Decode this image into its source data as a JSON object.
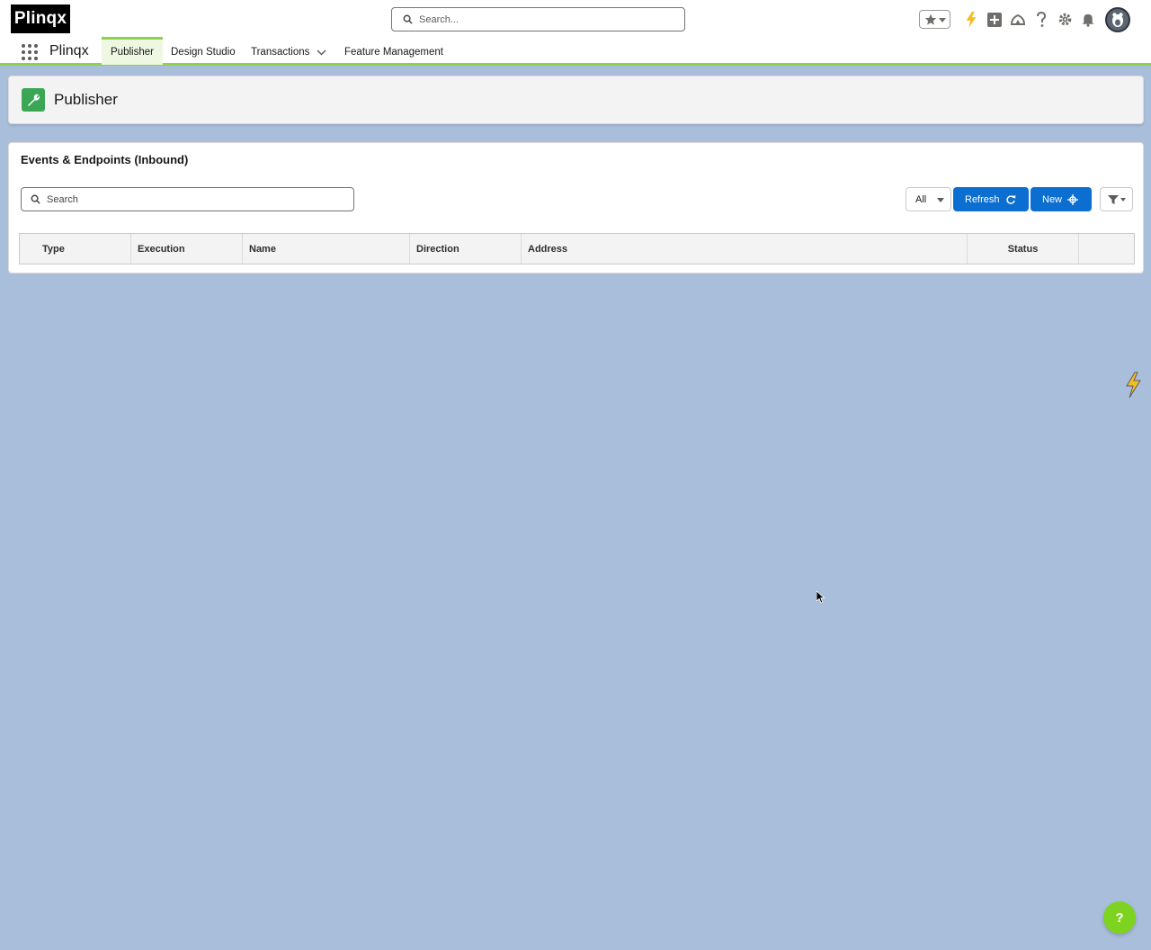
{
  "global_header": {
    "logo_text": "Plinqx",
    "search_placeholder": "Search..."
  },
  "app_nav": {
    "app_name": "Plinqx",
    "tabs": [
      {
        "label": "Publisher",
        "active": true
      },
      {
        "label": "Design Studio"
      },
      {
        "label": "Transactions",
        "has_menu": true
      },
      {
        "label": "Feature Management"
      }
    ]
  },
  "page_header": {
    "title": "Publisher"
  },
  "card": {
    "title": "Events & Endpoints (Inbound)",
    "search_placeholder": "Search",
    "filter_value": "All",
    "refresh_label": "Refresh",
    "new_label": "New",
    "columns": [
      "Type",
      "Execution",
      "Name",
      "Direction",
      "Address",
      "Status"
    ]
  },
  "help_label": "?",
  "colors": {
    "brand": "#0b6ed0",
    "accent_green": "#8fd14f",
    "page_icon": "#3ba755",
    "background": "#a9bedb"
  }
}
